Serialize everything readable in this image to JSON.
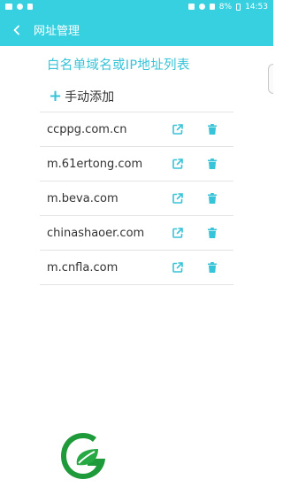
{
  "status_bar": {
    "battery": "8%",
    "time": "14:53"
  },
  "app_bar": {
    "back_icon": "chevron-left-icon",
    "title": "网址管理"
  },
  "main": {
    "heading": "白名单域名或IP地址列表",
    "add_label": "手动添加",
    "add_icon": "plus-icon",
    "accent_color": "#37c3d8",
    "domains": [
      "ccppg.com.cn",
      "m.61ertong.com",
      "m.beva.com",
      "chinashaoer.com",
      "m.cnfla.com"
    ],
    "row_icons": {
      "open": "open-external-icon",
      "delete": "trash-icon"
    }
  },
  "footer": {
    "logo_icon": "leaf-logo-icon"
  }
}
